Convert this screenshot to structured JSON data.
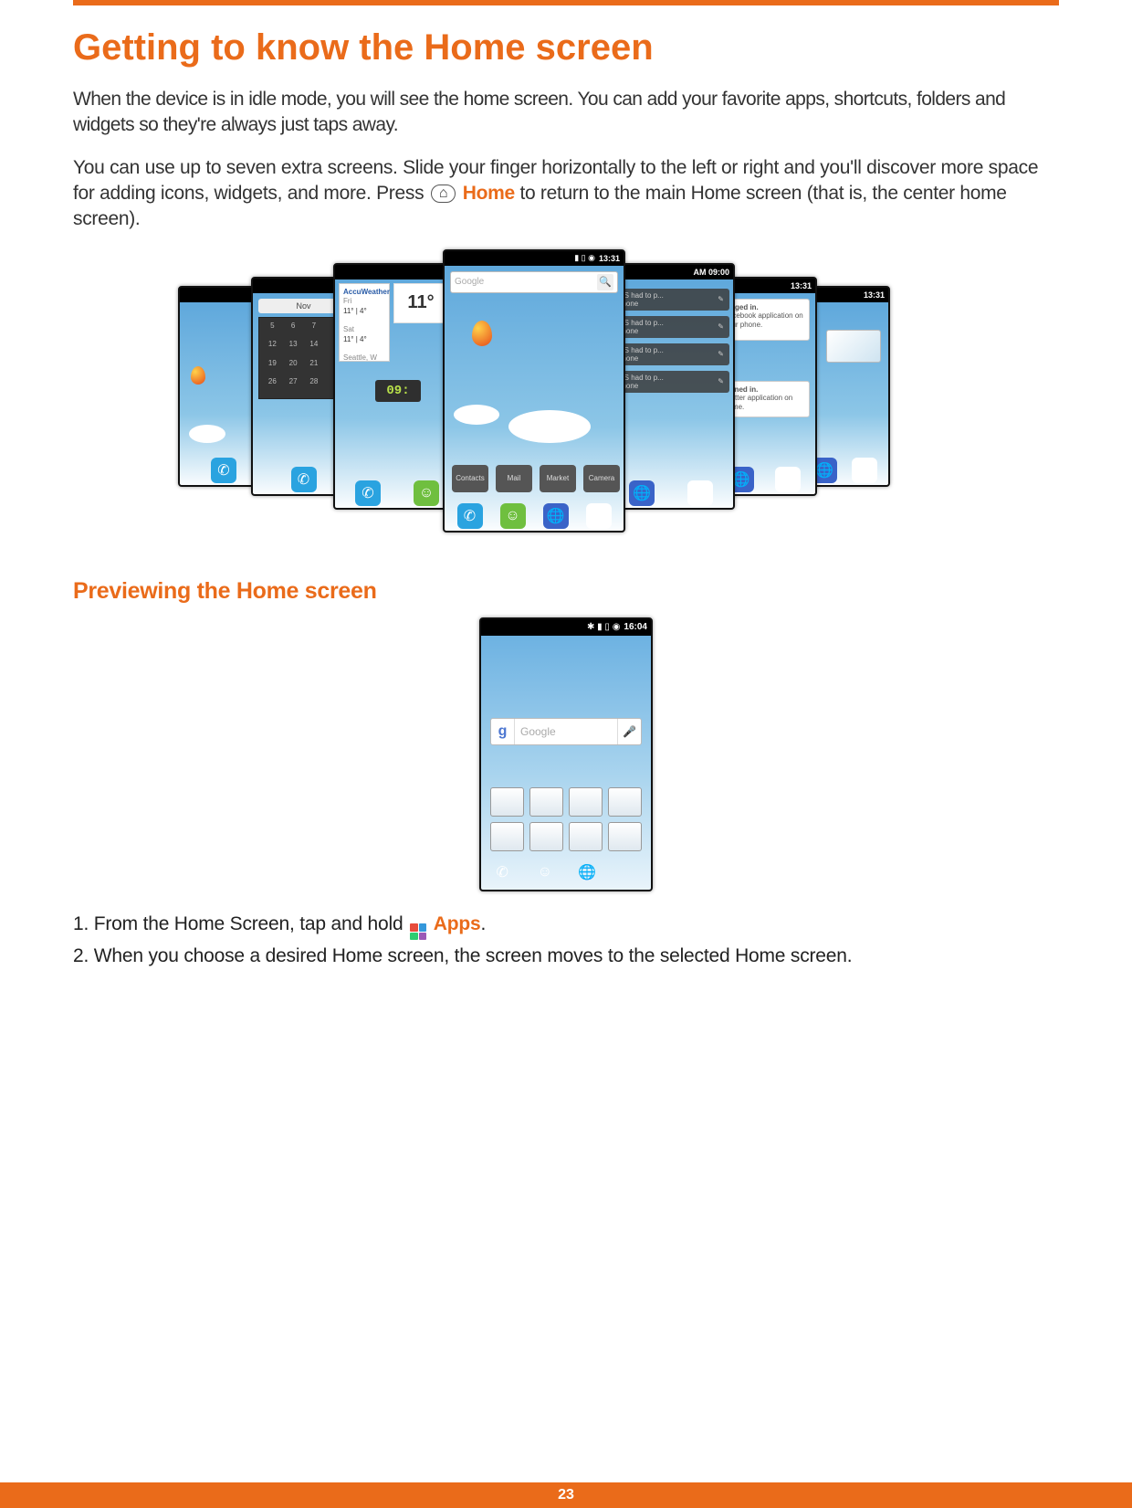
{
  "heading": "Getting to know the Home screen",
  "para1": "When the device is in idle mode, you will see the home screen. You can add your favorite apps, shortcuts, folders and widgets so they're always just taps away.",
  "para2_a": "You can use up to seven extra screens. Slide your finger horizontally to the left or right and you'll discover more space for adding icons, widgets, and more. Press ",
  "home_btn_glyph": "⌂",
  "home_label": "Home",
  "para2_b": " to return to the main Home screen (that is, the center home screen).",
  "sub_heading": "Previewing the Home screen",
  "step1_a": "1. From the Home Screen, tap and hold ",
  "apps_label": "Apps",
  "step1_b": ".",
  "step2": "2. When you choose a desired Home screen, the screen moves to the selected Home screen.",
  "page_number": "23",
  "fan": {
    "center": {
      "time": "13:31",
      "status_icons": "▮ ▯ ◉",
      "search_placeholder": "Google",
      "icon_labels": [
        "Contacts",
        "Mail",
        "Market",
        "Camera"
      ]
    },
    "left1": {
      "time": "",
      "accu": "AccuWeather",
      "fri": "Fri",
      "fri_range": "11° | 4°",
      "sat": "Sat",
      "sat_range": "11° | 4°",
      "city": "Seattle, W",
      "temp": "11°",
      "clock": "09:"
    },
    "left2": {
      "month": "Nov",
      "cal": [
        "5",
        "6",
        "7",
        "",
        "12",
        "13",
        "14",
        "",
        "19",
        "20",
        "21",
        "",
        "26",
        "27",
        "28",
        ""
      ]
    },
    "right1": {
      "time": "AM 09:00",
      "msg": "MS had to p...",
      "msg2": "phone"
    },
    "right2": {
      "time": "13:31",
      "n1a": "logged in.",
      "n1b": "Facebook application on your phone.",
      "n2a": "signed in.",
      "n2b": "Twitter application on home."
    },
    "outer": {
      "time": "13:31"
    }
  },
  "preview": {
    "time": "16:04",
    "status_icons": "✱ ▮ ▯ ◉",
    "search_placeholder": "Google",
    "g": "g"
  }
}
